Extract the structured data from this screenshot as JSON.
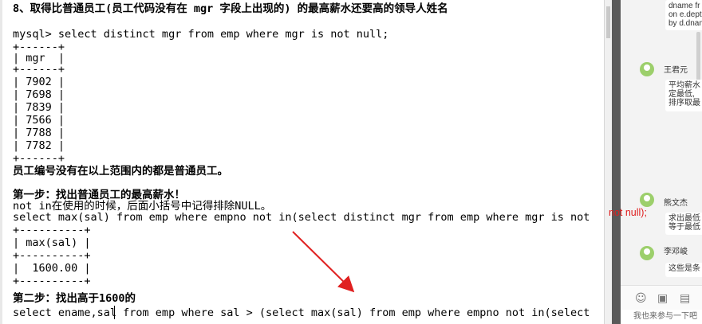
{
  "document": {
    "lines": [
      {
        "text": "8、取得比普通员工(员工代码没有在 mgr 字段上出现的) 的最高薪水还要高的领导人姓名",
        "bold": true
      },
      {
        "text": "",
        "bold": false
      },
      {
        "text": "mysql> select distinct mgr from emp where mgr is not null;",
        "bold": false
      },
      {
        "text": "+------+",
        "bold": false
      },
      {
        "text": "| mgr  |",
        "bold": false
      },
      {
        "text": "+------+",
        "bold": false
      },
      {
        "text": "| 7902 |",
        "bold": false
      },
      {
        "text": "| 7698 |",
        "bold": false
      },
      {
        "text": "| 7839 |",
        "bold": false
      },
      {
        "text": "| 7566 |",
        "bold": false
      },
      {
        "text": "| 7788 |",
        "bold": false
      },
      {
        "text": "| 7782 |",
        "bold": false
      },
      {
        "text": "+------+",
        "bold": false
      },
      {
        "text": "员工编号没有在以上范围内的都是普通员工。",
        "bold": true
      },
      {
        "text": "",
        "bold": false
      },
      {
        "text": "第一步：找出普通员工的最高薪水！",
        "bold": true
      },
      {
        "text": "not in在使用的时候，后面小括号中记得排除NULL。",
        "bold": false
      },
      {
        "text": "select max(sal) from emp where empno not in(select distinct mgr from emp where mgr is not",
        "bold": false
      },
      {
        "text": "+----------+",
        "bold": false
      },
      {
        "text": "| max(sal) |",
        "bold": false
      },
      {
        "text": "+----------+",
        "bold": false
      },
      {
        "text": "|  1600.00 |",
        "bold": false
      },
      {
        "text": "+----------+",
        "bold": false
      },
      {
        "text": "",
        "bold": false
      },
      {
        "text": "第二步：找出高于1600的",
        "bold": true
      },
      {
        "text": "select ename,sal from emp where sal > (select max(sal) from emp where empno not in(select",
        "bold": false
      }
    ],
    "overflow_text": "not null);"
  },
  "chat": {
    "top_snippet": "dname fr\non e.dept\nby d.dnam",
    "messages": [
      {
        "name": "王君元",
        "text": "平均薪水\n定最低,\n排序取最"
      },
      {
        "name": "熊文杰",
        "text": "求出最低\n等于最低"
      },
      {
        "name": "李邓峻",
        "text": "这些是条"
      }
    ],
    "input_placeholder": "我也来参与一下吧"
  },
  "colors": {
    "annotation": "#e02020",
    "avatar": "#9ccf6b"
  }
}
